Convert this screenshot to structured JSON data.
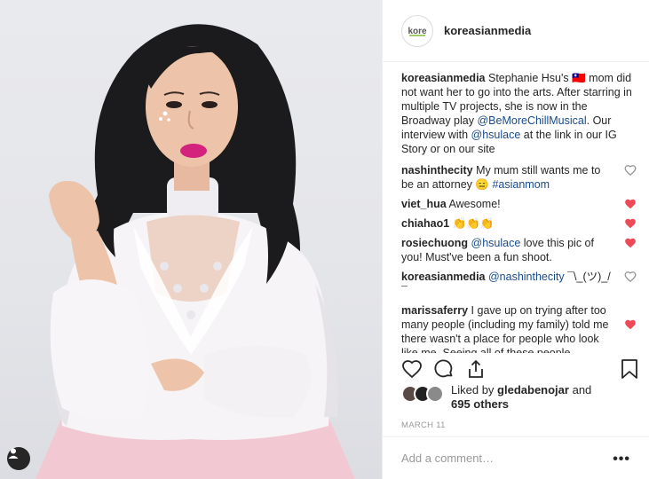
{
  "post": {
    "username": "koreasianmedia",
    "avatar_text": "kore",
    "caption": {
      "username": "koreasianmedia",
      "text_1": "Stephanie Hsu's",
      "flag": "🇹🇼",
      "text_2": "mom did not want her to go into the arts. After starring in multiple TV projects, she is now in the Broadway play",
      "mention_1": "@BeMoreChillMusical",
      "text_3": ". Our interview with",
      "mention_2": "@hsulace",
      "text_4": "at the link in our IG Story or on our site"
    },
    "comments": [
      {
        "username": "nashinthecity",
        "text": "My mum still wants me to be an attorney",
        "emoji": "😑",
        "hashtag": "#asianmom",
        "liked": false
      },
      {
        "username": "viet_hua",
        "text": "Awesome!",
        "liked": true
      },
      {
        "username": "chiahao1",
        "text": "👏👏👏",
        "liked": true
      },
      {
        "username": "rosiechuong",
        "mention": "@hsulace",
        "text": "love this pic of you! Must've been a fun shoot.",
        "liked": true
      },
      {
        "username": "koreasianmedia",
        "mention": "@nashinthecity",
        "text": "¯\\_(ツ)_/¯",
        "liked": false
      },
      {
        "username": "marissaferry",
        "text": "I gave up on trying after too many people (including my family) told me there wasn't a place for people who look like me. Seeing all of these people",
        "liked": true
      }
    ],
    "likes": {
      "prefix": "Liked by",
      "user": "gledabenojar",
      "and": "and",
      "others": "695 others"
    },
    "date": "MARCH 11",
    "add_comment_placeholder": "Add a comment…",
    "more_icon": "•••"
  },
  "icons": {
    "like": "heart-outline-icon",
    "comment": "comment-bubble-icon",
    "share": "share-icon",
    "save": "bookmark-icon",
    "options": "more-options-icon",
    "user_tag": "user-tag-icon"
  },
  "colors": {
    "liked_heart": "#ed4956",
    "mention": "#1a4b8c",
    "text": "#262626",
    "muted": "#999999"
  }
}
